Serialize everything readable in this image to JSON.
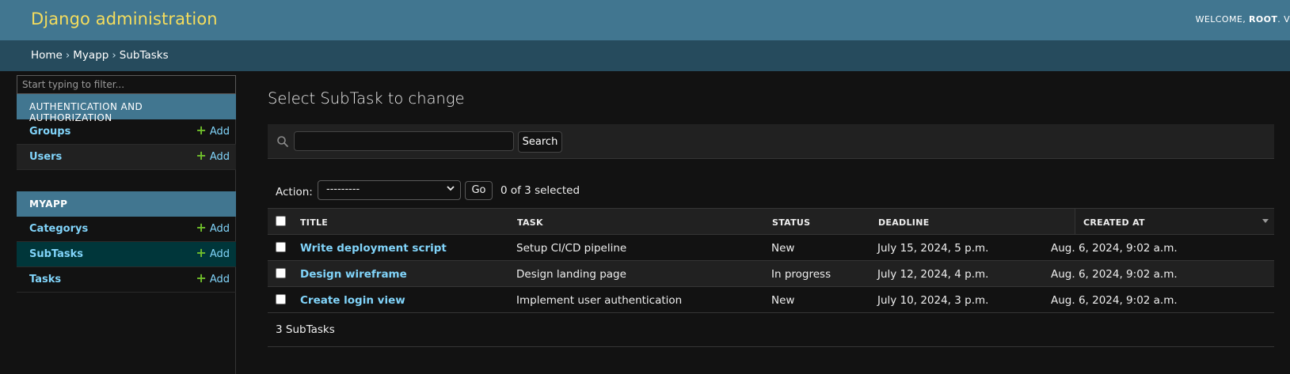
{
  "header": {
    "branding": "Django administration",
    "welcome": "WELCOME,",
    "user": "ROOT",
    "trailing": ". V"
  },
  "breadcrumbs": [
    "Home",
    "Myapp",
    "SubTasks"
  ],
  "breadcrumb_separator": "›",
  "sidebar": {
    "filter_placeholder": "Start typing to filter...",
    "apps": [
      {
        "caption": "AUTHENTICATION AND AUTHORIZATION",
        "models": [
          {
            "name": "Groups",
            "add": "Add"
          },
          {
            "name": "Users",
            "add": "Add"
          }
        ]
      },
      {
        "caption": "MYAPP",
        "models": [
          {
            "name": "Categorys",
            "add": "Add"
          },
          {
            "name": "SubTasks",
            "add": "Add",
            "current": true
          },
          {
            "name": "Tasks",
            "add": "Add"
          }
        ]
      }
    ]
  },
  "content": {
    "title": "Select SubTask to change",
    "search_button": "Search",
    "search_value": "",
    "action_label": "Action:",
    "action_selected": "---------",
    "go_button": "Go",
    "action_counter": "0 of 3 selected",
    "columns": [
      "TITLE",
      "TASK",
      "STATUS",
      "DEADLINE",
      "CREATED AT"
    ],
    "rows": [
      {
        "title": "Write deployment script",
        "task": "Setup CI/CD pipeline",
        "status": "New",
        "deadline": "July 15, 2024, 5 p.m.",
        "created_at": "Aug. 6, 2024, 9:02 a.m."
      },
      {
        "title": "Design wireframe",
        "task": "Design landing page",
        "status": "In progress",
        "deadline": "July 12, 2024, 4 p.m.",
        "created_at": "Aug. 6, 2024, 9:02 a.m."
      },
      {
        "title": "Create login view",
        "task": "Implement user authentication",
        "status": "New",
        "deadline": "July 10, 2024, 3 p.m.",
        "created_at": "Aug. 6, 2024, 9:02 a.m."
      }
    ],
    "paginator": "3 SubTasks"
  },
  "colors": {
    "header_bg": "#417690",
    "branding": "#f5dd5d",
    "breadcrumbs_bg": "#264b5d",
    "link": "#81d4fa",
    "add_plus": "#70bf2b",
    "current_row": "#00363a",
    "page_bg": "#121212"
  },
  "icons": [
    "search-icon",
    "plus-icon",
    "chevron-down-icon",
    "sort-descending-icon"
  ]
}
